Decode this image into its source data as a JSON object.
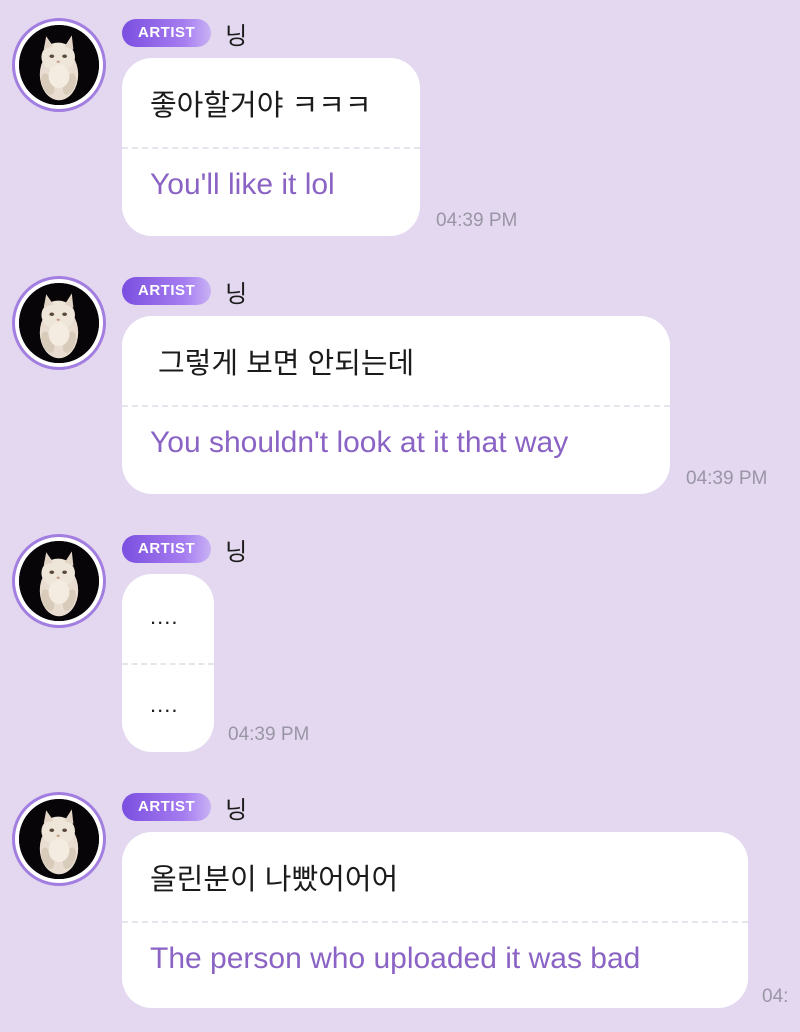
{
  "messages": [
    {
      "badge": "ARTIST",
      "sender": "닝",
      "original": "좋아할거야 ㅋㅋㅋ",
      "translation": "You'll like it lol",
      "time": "04:39 PM"
    },
    {
      "badge": "ARTIST",
      "sender": "닝",
      "original": "그렇게 보면 안되는데",
      "translation": "You shouldn't look at it that way",
      "time": "04:39 PM"
    },
    {
      "badge": "ARTIST",
      "sender": "닝",
      "original": "....",
      "translation": "....",
      "time": "04:39 PM"
    },
    {
      "badge": "ARTIST",
      "sender": "닝",
      "original": "올린분이 나빴어어어",
      "translation": "The person who uploaded it was bad",
      "time": "04:"
    }
  ],
  "colors": {
    "background": "#e3d8f0",
    "badge_start": "#7b4fe0",
    "badge_end": "#c8b2f5",
    "translation_text": "#8a63c4",
    "timestamp": "#9a95a5"
  },
  "icons": {
    "avatar": "white-cat-avatar"
  }
}
